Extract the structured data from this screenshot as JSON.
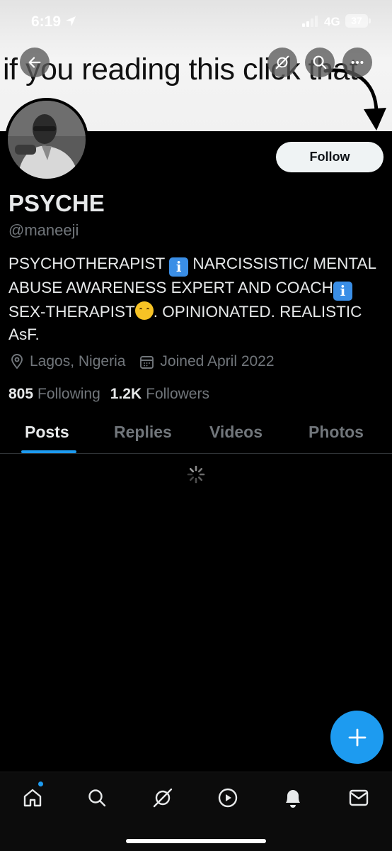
{
  "status_bar": {
    "time": "6:19",
    "network": "4G",
    "battery": "37"
  },
  "banner": {
    "text": "if you reading this click that"
  },
  "header_buttons": {
    "back_icon": "arrow-left-icon",
    "grok_icon": "grok-icon",
    "search_icon": "search-icon",
    "more_icon": "more-icon"
  },
  "profile": {
    "follow_label": "Follow",
    "display_name": "PSYCHE",
    "handle": "@maneeji",
    "bio": {
      "part1": "PSYCHOTHERAPIST ",
      "info_glyph": "i",
      "part2": " NARCISSISTIC/ MENTAL ABUSE AWARENESS EXPERT AND COACH",
      "part3": " SEX-THERAPIST",
      "part4": ". OPINIONATED. REALISTIC AsF."
    },
    "location": "Lagos, Nigeria",
    "joined": "Joined April 2022",
    "following_count": "805",
    "following_label": "Following",
    "followers_count": "1.2K",
    "followers_label": "Followers"
  },
  "tabs": [
    {
      "label": "Posts",
      "active": true
    },
    {
      "label": "Replies",
      "active": false
    },
    {
      "label": "Videos",
      "active": false
    },
    {
      "label": "Photos",
      "active": false
    }
  ],
  "bottom_nav": [
    {
      "icon": "home-icon",
      "has_dot": true
    },
    {
      "icon": "search-icon"
    },
    {
      "icon": "grok-icon"
    },
    {
      "icon": "video-icon"
    },
    {
      "icon": "notifications-icon"
    },
    {
      "icon": "messages-icon"
    }
  ],
  "colors": {
    "accent": "#1d9bf0",
    "background": "#000000",
    "secondary_text": "#71767b",
    "primary_text": "#e7e9ea"
  }
}
